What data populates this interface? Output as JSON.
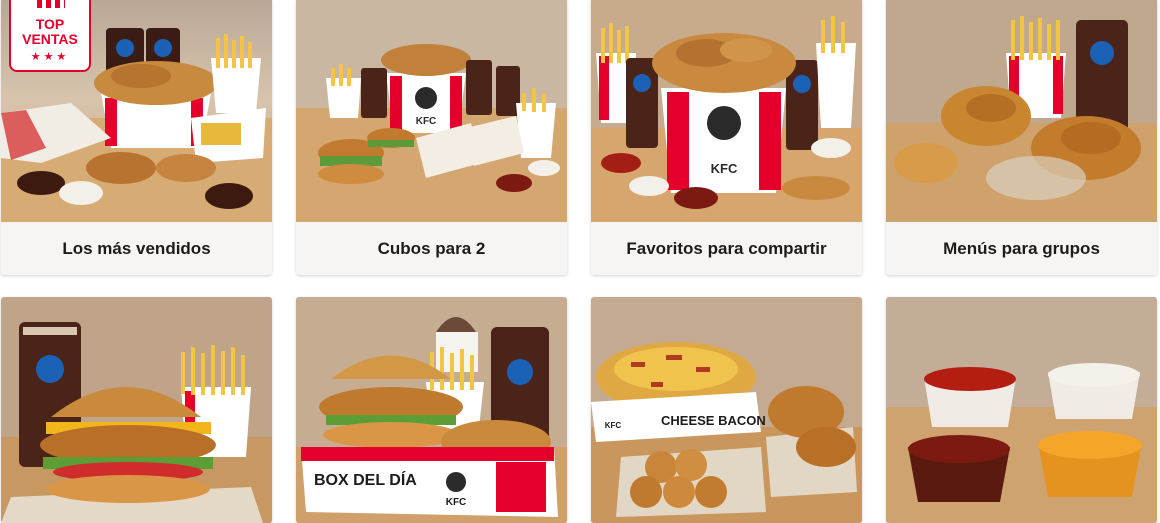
{
  "badge": {
    "line1": "TOP",
    "line2": "VENTAS",
    "stars": "★★★"
  },
  "categories": [
    {
      "label": "Los más vendidos"
    },
    {
      "label": "Cubos para 2"
    },
    {
      "label": "Favoritos para compartir"
    },
    {
      "label": "Menús para grupos"
    }
  ],
  "product_text": {
    "bucket_brand": "KFC",
    "box_del_dia": "BOX DEL DÍA",
    "cheese_bacon": "CHEESE BACON"
  },
  "colors": {
    "brand_red": "#e4002b",
    "label_bg": "#f6f5f3"
  }
}
